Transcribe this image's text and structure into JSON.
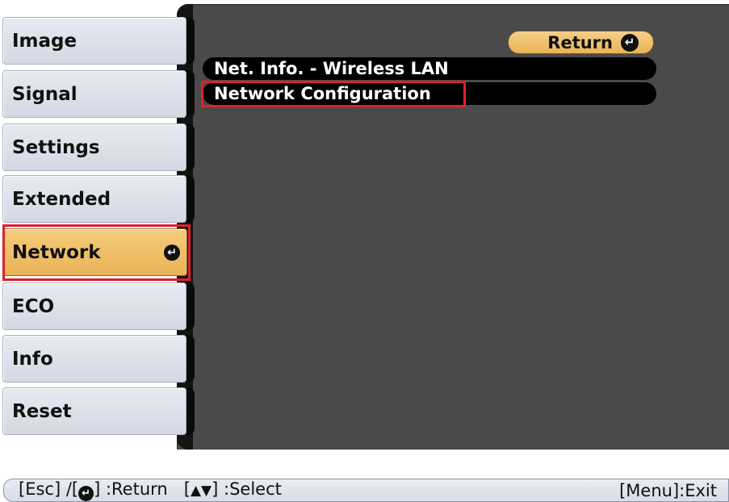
{
  "sidebar": {
    "items": [
      {
        "label": "Image"
      },
      {
        "label": "Signal"
      },
      {
        "label": "Settings"
      },
      {
        "label": "Extended"
      },
      {
        "label": "Network",
        "selected": true
      },
      {
        "label": "ECO"
      },
      {
        "label": "Info"
      },
      {
        "label": "Reset"
      }
    ]
  },
  "submenu": {
    "return_label": "Return",
    "items": [
      {
        "label": "Net. Info. - Wireless LAN"
      },
      {
        "label": "Network Configuration",
        "highlighted": true
      }
    ]
  },
  "statusbar": {
    "esc_key": "[Esc] /[",
    "return_hint": "] :Return",
    "select_key_open": "[",
    "select_hint": "] :Select",
    "exit_hint": "[Menu]:Exit"
  },
  "colors": {
    "accent": "#eab458",
    "highlight_border": "#e0202a",
    "panel": "#4a4a4a"
  },
  "icons": {
    "enter": "enter-icon",
    "updown": "up-down-arrow-icon"
  }
}
